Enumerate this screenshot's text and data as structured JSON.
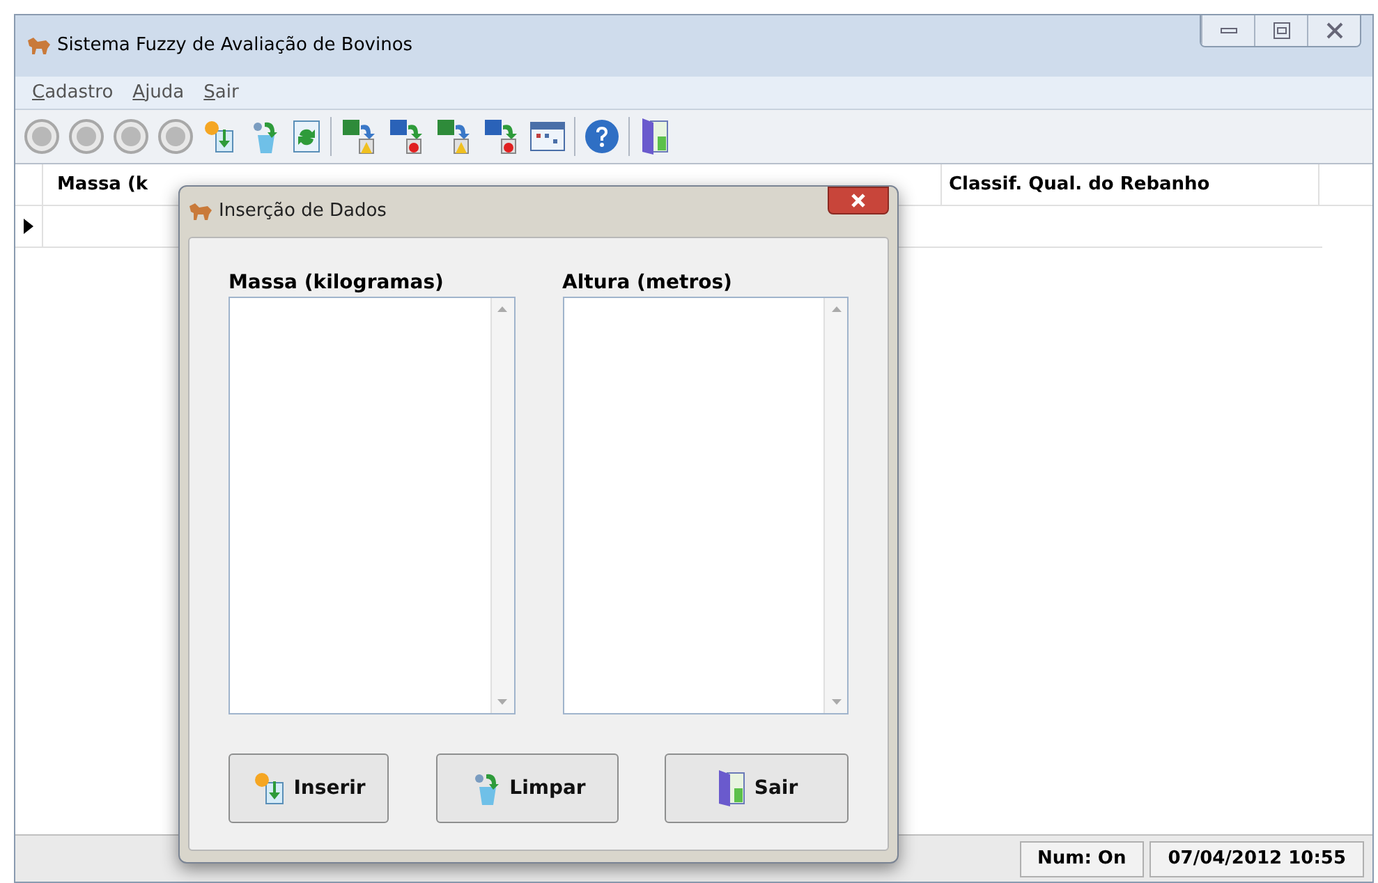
{
  "window": {
    "title": "Sistema Fuzzy de Avaliação de Bovinos"
  },
  "menu": [
    {
      "label": "Cadastro"
    },
    {
      "label": "Ajuda"
    },
    {
      "label": "Sair"
    }
  ],
  "grid": {
    "columns": [
      "Massa (k",
      "Classif. Qual. do Rebanho"
    ]
  },
  "status_bar": [
    "Num: On",
    "07/04/2012 10:55"
  ],
  "dialog": {
    "title": "Inserção de Dados",
    "lists": [
      {
        "label": "Massa (kilogramas)"
      },
      {
        "label": "Altura (metros)"
      }
    ],
    "buttons": [
      {
        "label": "Inserir",
        "kind": "insert"
      },
      {
        "label": "Limpar",
        "kind": "clear"
      },
      {
        "label": "Sair",
        "kind": "exit"
      }
    ]
  }
}
